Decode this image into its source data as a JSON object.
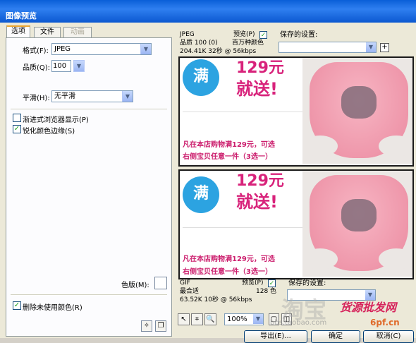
{
  "window": {
    "title": "图像预览"
  },
  "tabs": [
    {
      "label": "选项",
      "state": "active"
    },
    {
      "label": "文件",
      "state": "normal"
    },
    {
      "label": "动画",
      "state": "disabled"
    }
  ],
  "options": {
    "format_label": "格式(F):",
    "format_value": "JPEG",
    "quality_label": "品质(Q):",
    "quality_value": "100",
    "smoothing_label": "平滑(H):",
    "smoothing_value": "无平滑",
    "progressive_label": "渐进式浏览器显示(P)",
    "progressive_checked": false,
    "sharpen_label": "锐化颜色边缘(S)",
    "sharpen_checked": true,
    "matte_label": "色版(M):",
    "remove_unused_label": "删除未使用颜色(R)",
    "remove_unused_checked": true
  },
  "preview_top": {
    "format": "JPEG",
    "preview_label": "预览(P)",
    "preview_checked": true,
    "quality_line": "品质 100 (0)",
    "colors": "百万种颜色",
    "size_line": "204.41K  32秒 @ 56kbps",
    "saved_settings_label": "保存的设置:"
  },
  "preview_bottom": {
    "format": "GIF",
    "preview_label": "预览(P)",
    "preview_checked": true,
    "quality_line": "最合适",
    "colors": "128 色",
    "size_line": "63.52K  10秒 @ 56kbps",
    "saved_settings_label": "保存的设置:"
  },
  "ad": {
    "circle_text": "满",
    "price": "129元",
    "send": "就送!",
    "line1": "凡在本店购物满129元，可选",
    "line2": "右侧宝贝任意一件（3选一）"
  },
  "toolbar": {
    "zoom": "100%",
    "arrow_icon": "↖",
    "crop_icon": "⌗",
    "zoom_icon": "🔍"
  },
  "buttons": {
    "export": "导出(E)...",
    "ok": "确定",
    "cancel": "取消(C)"
  },
  "watermark": {
    "text1": "货源批发网",
    "text2": "6pf.cn",
    "text3": "淘宝",
    "text4": "bbs.taobao.com"
  },
  "colors": {
    "title_bar": "#0a5fd8",
    "accent": "#d8237b",
    "circle": "#2ca3e1"
  }
}
